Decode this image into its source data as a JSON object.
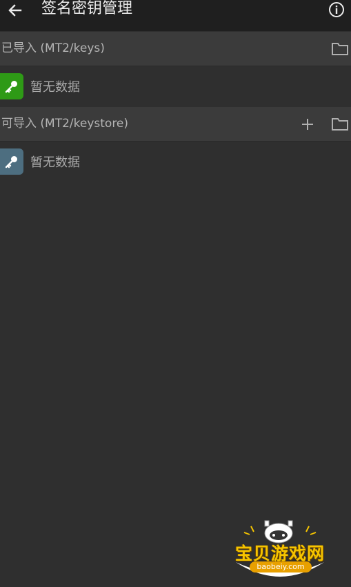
{
  "app_bar": {
    "title": "签名密钥管理",
    "back_icon": "arrow-left-icon",
    "info_icon": "info-icon"
  },
  "sections": [
    {
      "title": "已导入 (MT2/keys)",
      "actions": [
        "folder-icon"
      ],
      "empty_text": "暂无数据",
      "key_color": "#2e9a16"
    },
    {
      "title": "可导入 (MT2/keystore)",
      "actions": [
        "plus-icon",
        "folder-icon"
      ],
      "empty_text": "暂无数据",
      "key_color": "#4d6e80"
    }
  ],
  "watermark": {
    "title": "宝贝游戏网",
    "url": "baobeiy.com"
  }
}
